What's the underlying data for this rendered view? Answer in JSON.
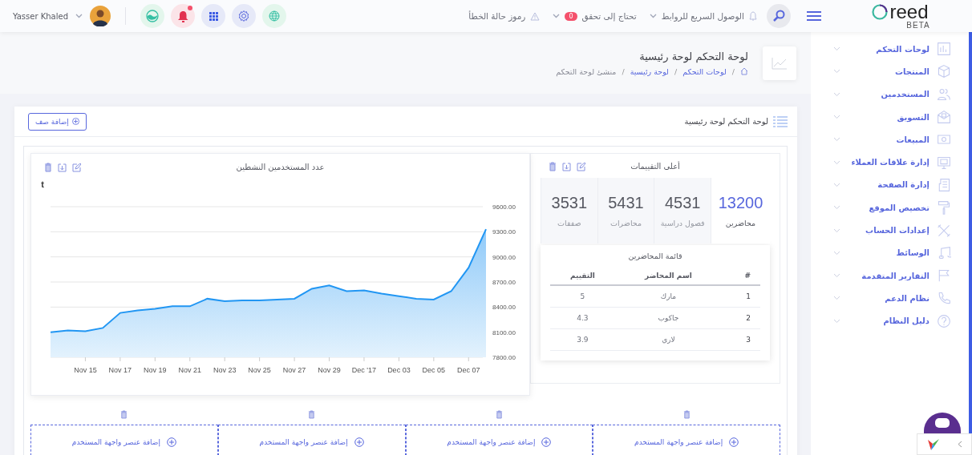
{
  "header": {
    "logo": {
      "text": "reed",
      "badge": "BETA"
    },
    "top_links": [
      {
        "label": "الوصول السريع للروابط",
        "dropdown": true
      },
      {
        "label": "تحتاج إلى تحقق",
        "count": "0",
        "dropdown": true
      },
      {
        "label": "رموز حالة الخطأ",
        "dropdown": false
      }
    ],
    "bell_unread": true,
    "user": {
      "name": "Yasser Khaled"
    }
  },
  "page_header": {
    "title": "لوحة التحكم لوحة رئيسية",
    "separator": "/",
    "breadcrumb": [
      {
        "label": "لوحات التحكم",
        "link": true
      },
      {
        "label": "لوحة رئيسية",
        "link": true
      },
      {
        "label": "منشئ لوحة التحكم",
        "link": false
      }
    ]
  },
  "sidebar": {
    "items": [
      {
        "label": "لوحات التحكم"
      },
      {
        "label": "المنتجات"
      },
      {
        "label": "المستخدمين"
      },
      {
        "label": "التسويق"
      },
      {
        "label": "المبيعات"
      },
      {
        "label": "إدارة علاقات العملاء"
      },
      {
        "label": "إدارة الصفحة"
      },
      {
        "label": "تخصيص الموقع"
      },
      {
        "label": "إعدادات الحساب"
      },
      {
        "label": "الوسائط"
      },
      {
        "label": "التقارير المتقدمة"
      },
      {
        "label": "نظام الدعم"
      },
      {
        "label": "دليل النظام"
      }
    ]
  },
  "dashboard": {
    "title": "لوحة التحكم لوحة رئيسية",
    "add_row_button": "إضافة صف"
  },
  "ratings_widget": {
    "title": "أعلى التقييمات",
    "stats": [
      {
        "value": "13200",
        "label": "محاضرين",
        "selected": true
      },
      {
        "value": "4531",
        "label": "فصول دراسية",
        "selected": false
      },
      {
        "value": "5431",
        "label": "محاضرات",
        "selected": false
      },
      {
        "value": "3531",
        "label": "صفقات",
        "selected": false
      }
    ],
    "table": {
      "title": "قائمة المحاضرين",
      "columns": [
        "#",
        "اسم المحاضر",
        "التقييم"
      ],
      "rows": [
        [
          "1",
          "مارك",
          "5"
        ],
        [
          "2",
          "جاكوب",
          "4.3"
        ],
        [
          "3",
          "لاري",
          "3.9"
        ]
      ]
    }
  },
  "chart_widget": {
    "title": "عدد المستخدمين النشطين",
    "corner_label": "t",
    "chart_data": {
      "type": "area",
      "categories": [
        null,
        null,
        "Nov 15",
        null,
        "Nov 17",
        null,
        "Nov 19",
        null,
        "Nov 21",
        null,
        "Nov 23",
        null,
        "Nov 25",
        null,
        "Nov 27",
        null,
        "Nov 29",
        null,
        "Dec '17",
        null,
        "Dec 03",
        null,
        "Dec 05",
        null,
        "Dec 07",
        null
      ],
      "series": [
        {
          "color": "#2196f3",
          "values": [
            8100,
            8120,
            8110,
            8150,
            8330,
            8360,
            8380,
            8410,
            8410,
            8500,
            8470,
            8480,
            8480,
            8490,
            8500,
            8620,
            8660,
            8590,
            8600,
            8560,
            8530,
            8500,
            8490,
            8590,
            8870,
            9330
          ]
        }
      ],
      "ylim": [
        7800,
        9600
      ],
      "yticks": [
        {
          "value": 7800,
          "label": "7800.00"
        },
        {
          "value": 8100,
          "label": "8100.00"
        },
        {
          "value": 8400,
          "label": "8400.00"
        },
        {
          "value": 8700,
          "label": "8700.00"
        },
        {
          "value": 9000,
          "label": "9000.00"
        },
        {
          "value": 9300,
          "label": "9300.00"
        },
        {
          "value": 9600,
          "label": "9600.00"
        }
      ],
      "grid": true
    }
  },
  "slots": [
    {
      "label": "إضافة عنصر واجهة المستخدم"
    },
    {
      "label": "إضافة عنصر واجهة المستخدم"
    },
    {
      "label": "إضافة عنصر واجهة المستخدم"
    },
    {
      "label": "إضافة عنصر واجهة المستخدم"
    }
  ]
}
